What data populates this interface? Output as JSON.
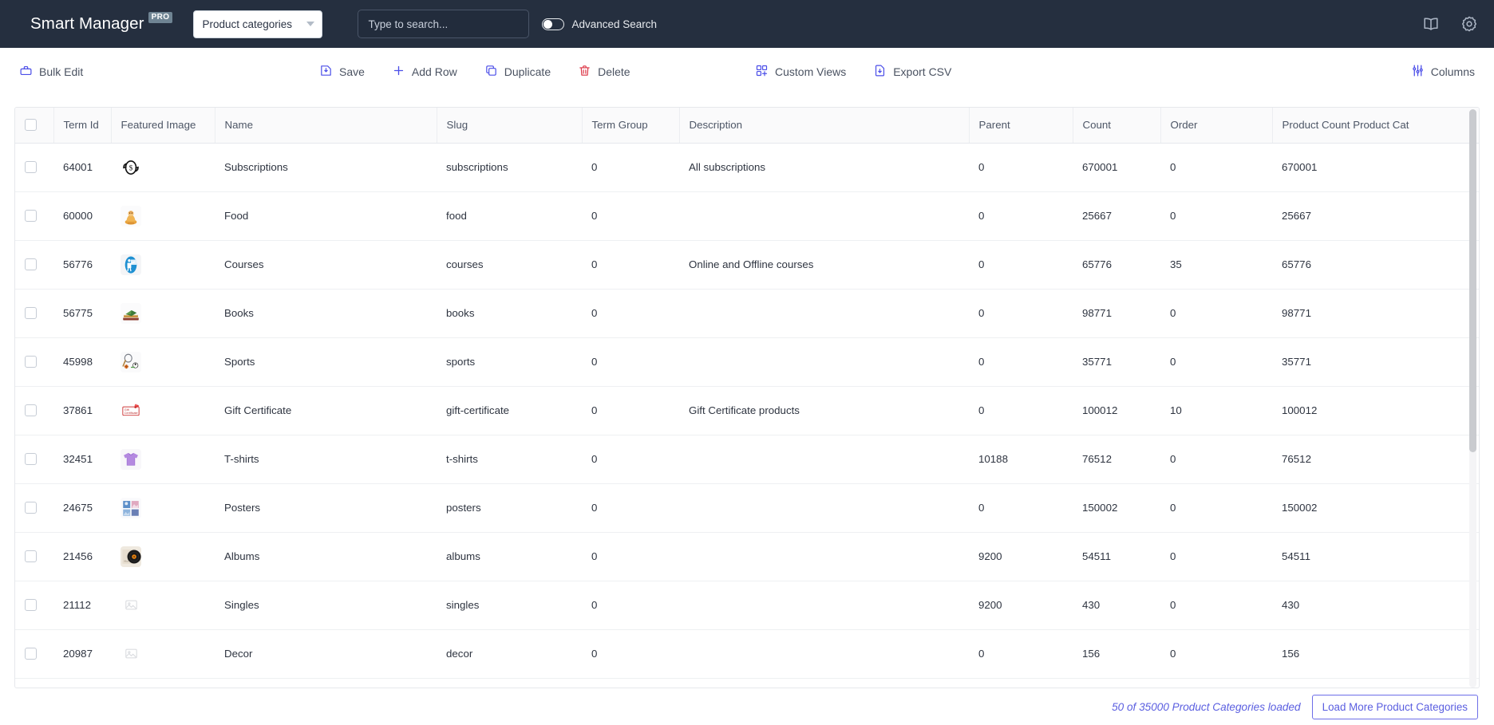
{
  "header": {
    "brand_name": "Smart Manager",
    "brand_badge": "PRO",
    "dashboard_select_value": "Product categories",
    "search_placeholder": "Type to search...",
    "search_value": "",
    "advanced_search_label": "Advanced Search",
    "advanced_search_on": false,
    "icons": {
      "docs": "book-icon",
      "settings": "gear-icon"
    },
    "bg_color": "#252f3f"
  },
  "toolbar": {
    "bulk_edit": "Bulk Edit",
    "save": "Save",
    "add_row": "Add Row",
    "duplicate": "Duplicate",
    "delete": "Delete",
    "custom_views": "Custom Views",
    "export_csv": "Export CSV",
    "columns": "Columns",
    "accent_color": "#4b4ee8",
    "danger_color": "#dc3545"
  },
  "table": {
    "columns": [
      "Term Id",
      "Featured Image",
      "Name",
      "Slug",
      "Term Group",
      "Description",
      "Parent",
      "Count",
      "Order",
      "Product Count Product Cat"
    ],
    "rows": [
      {
        "term_id": "64001",
        "image": "subscription-icon",
        "name": "Subscriptions",
        "slug": "subscriptions",
        "term_group": "0",
        "description": "All subscriptions",
        "parent": "0",
        "count": "670001",
        "order": "0",
        "product_count": "670001"
      },
      {
        "term_id": "60000",
        "image": "food-thumbnail",
        "name": "Food",
        "slug": "food",
        "term_group": "0",
        "description": "",
        "parent": "0",
        "count": "25667",
        "order": "0",
        "product_count": "25667"
      },
      {
        "term_id": "56776",
        "image": "courses-thumbnail",
        "name": "Courses",
        "slug": "courses",
        "term_group": "0",
        "description": "Online and Offline courses",
        "parent": "0",
        "count": "65776",
        "order": "35",
        "product_count": "65776"
      },
      {
        "term_id": "56775",
        "image": "books-thumbnail",
        "name": "Books",
        "slug": "books",
        "term_group": "0",
        "description": "",
        "parent": "0",
        "count": "98771",
        "order": "0",
        "product_count": "98771"
      },
      {
        "term_id": "45998",
        "image": "sports-thumbnail",
        "name": "Sports",
        "slug": "sports",
        "term_group": "0",
        "description": "",
        "parent": "0",
        "count": "35771",
        "order": "0",
        "product_count": "35771"
      },
      {
        "term_id": "37861",
        "image": "gift-certificate-thumbnail",
        "name": "Gift Certificate",
        "slug": "gift-certificate",
        "term_group": "0",
        "description": "Gift Certificate products",
        "parent": "0",
        "count": "100012",
        "order": "10",
        "product_count": "100012"
      },
      {
        "term_id": "32451",
        "image": "tshirt-thumbnail",
        "name": "T-shirts",
        "slug": "t-shirts",
        "term_group": "0",
        "description": "",
        "parent": "10188",
        "count": "76512",
        "order": "0",
        "product_count": "76512"
      },
      {
        "term_id": "24675",
        "image": "posters-thumbnail",
        "name": "Posters",
        "slug": "posters",
        "term_group": "0",
        "description": "",
        "parent": "0",
        "count": "150002",
        "order": "0",
        "product_count": "150002"
      },
      {
        "term_id": "21456",
        "image": "albums-thumbnail",
        "name": "Albums",
        "slug": "albums",
        "term_group": "0",
        "description": "",
        "parent": "9200",
        "count": "54511",
        "order": "0",
        "product_count": "54511"
      },
      {
        "term_id": "21112",
        "image": "image-placeholder-icon",
        "name": "Singles",
        "slug": "singles",
        "term_group": "0",
        "description": "",
        "parent": "9200",
        "count": "430",
        "order": "0",
        "product_count": "430"
      },
      {
        "term_id": "20987",
        "image": "image-placeholder-icon",
        "name": "Decor",
        "slug": "decor",
        "term_group": "0",
        "description": "",
        "parent": "0",
        "count": "156",
        "order": "0",
        "product_count": "156"
      }
    ]
  },
  "footer": {
    "loaded_text": "50 of 35000 Product Categories loaded",
    "load_more_label": "Load More Product Categories",
    "accent_color": "#5a5ee0"
  }
}
